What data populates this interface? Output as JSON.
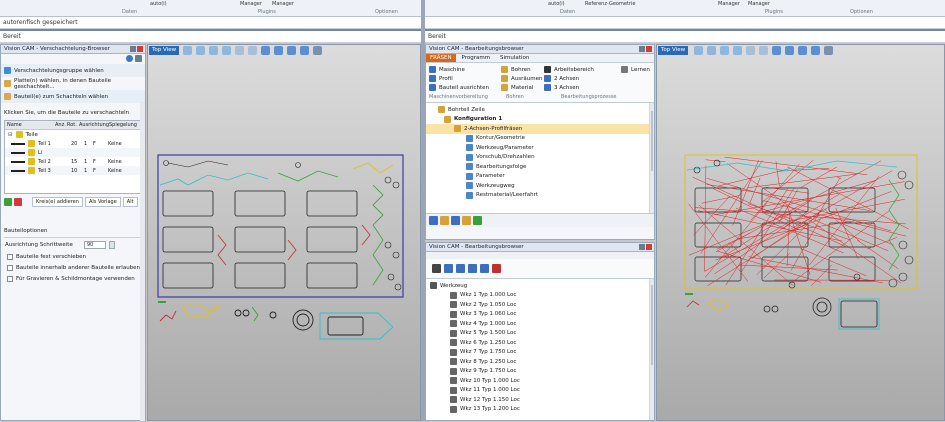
{
  "ribbon": {
    "left_small_labels": [
      "auto(i)",
      "Manager",
      "Manager"
    ],
    "right_small_labels": [
      "auto(i)",
      "Referenz-Geometrie",
      "Manager",
      "Manager"
    ],
    "left_groups": [
      "Daten",
      "Plugins",
      "Optionen"
    ],
    "right_groups": [
      "Daten",
      "Plugins",
      "Optionen"
    ]
  },
  "left_command_line": "autorenfisch gespeichert",
  "left_status_line": "Bereit",
  "right_status_line": "Bereit",
  "nesting": {
    "title": "Vision CAM - Verschachtelung-Browser",
    "actions": [
      "Verschachtelungsgruppe wählen",
      "Platte(n) wählen, in denen Bauteile geschachtelt...",
      "Bauteil(e) zum Schachteln wählen"
    ],
    "info_text": "Klicken Sie, um die Bauteile zu verschachteln",
    "table_headers": [
      "Name",
      "Anz.",
      "Rot.",
      "Ausrichtung",
      "Spiegelung"
    ],
    "group_name": "Teile",
    "rows": [
      {
        "name": "Teil 1",
        "qty": "20",
        "rot": "1",
        "align": "F",
        "mirror": "Keine"
      },
      {
        "name": "Li",
        "qty": "",
        "rot": "",
        "align": "",
        "mirror": ""
      },
      {
        "name": "Teil 2",
        "qty": "15",
        "rot": "1",
        "align": "F",
        "mirror": "Keine"
      },
      {
        "name": "Teil 3",
        "qty": "10",
        "rot": "1",
        "align": "F",
        "mirror": "Keine"
      }
    ],
    "buttons": [
      "Kreis(e) addieren",
      "Als Vorlage",
      "Alt"
    ],
    "options_title": "Bauteiloptionen",
    "angle_label": "Ausrichtung Schrittweite",
    "angle_value": "90",
    "checkboxes": [
      "Bauteile fest verschieben",
      "Bauteile innerhalb anderer Bauteile erlauben",
      "Für Gravieren & Schildmontage verwenden"
    ]
  },
  "left_view_label": "Top View",
  "right_view_label": "Top View",
  "machining": {
    "title": "Vision CAM - Bearbeitungsbrowser",
    "tabs": [
      "FRÄSEN",
      "Programm",
      "Simulation"
    ],
    "ribbon_col1": [
      "Maschine",
      "Profil",
      "Bauteil ausrichten"
    ],
    "ribbon_col2": [
      "Bohren",
      "Ausräumen",
      "Material"
    ],
    "ribbon_col3": [
      "Arbeitsbereich",
      "2 Achsen",
      "3 Achsen"
    ],
    "ribbon_extra": "Lernen",
    "ribbon_groups": [
      "Maschinenvorbereitung",
      "Bohren",
      "Bearbeitungsprozesse"
    ],
    "tree": [
      "Bohrteil Zeile",
      "Konfiguration 1",
      "2-Achsen-Profilfräsen",
      "Kontur/Geometrie",
      "Werkzeug/Parameter",
      "Vorschub/Drehzahlen",
      "Bearbeitungsfolge",
      "Parameter",
      "Werkzeugweg",
      "Restmaterial/Leerfahrt"
    ]
  },
  "tools": {
    "title": "Vision CAM - Bearbeitungsbrowser",
    "root": "Werkzeug",
    "items": [
      "Wkz 1 Typ 1.000 Loc",
      "Wkz 2 Typ 1.050 Loc",
      "Wkz 3 Typ 1.060 Loc",
      "Wkz 4 Typ 1.000 Loc",
      "Wkz 5 Typ 1.500 Loc",
      "Wkz 6 Typ 1.250 Loc",
      "Wkz 7 Typ 1.750 Loc",
      "Wkz 8 Typ 1.250 Loc",
      "Wkz 9 Typ 1.750 Loc",
      "Wkz 10 Typ 1.000 Loc",
      "Wkz 11 Typ 1.000 Loc",
      "Wkz 12 Typ 1.150 Loc",
      "Wkz 13 Typ 1.200 Loc"
    ]
  },
  "colors": {
    "accent": "#2a6ab5",
    "toolpath": "#e02020",
    "sheet": "#3a3aa8",
    "part_green": "#3aa13a",
    "part_yellow": "#e0c020",
    "part_cyan": "#30c0c8"
  }
}
